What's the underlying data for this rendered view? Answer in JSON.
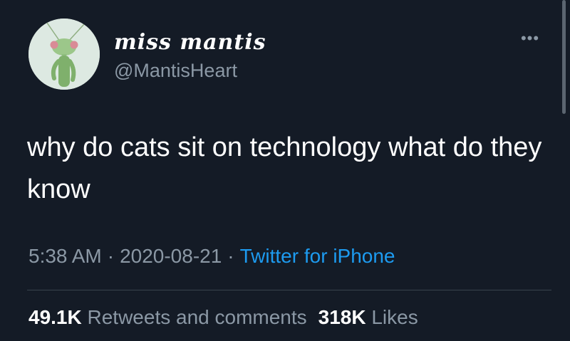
{
  "user": {
    "display_name": "miss mantis",
    "handle": "@MantisHeart",
    "avatar_icon": "praying-mantis-avatar"
  },
  "more_icon": "more-options-icon",
  "tweet": {
    "text": "why do cats sit on technology what do they know"
  },
  "meta": {
    "time": "5:38 AM",
    "separator": "·",
    "date": "2020-08-21",
    "source": "Twitter for iPhone"
  },
  "stats": {
    "retweets_count": "49.1K",
    "retweets_label": "Retweets and comments",
    "likes_count": "318K",
    "likes_label": "Likes"
  },
  "colors": {
    "background": "#141b26",
    "secondary_text": "#8b98a5",
    "link": "#1d9bf0",
    "divider": "#38444d"
  }
}
